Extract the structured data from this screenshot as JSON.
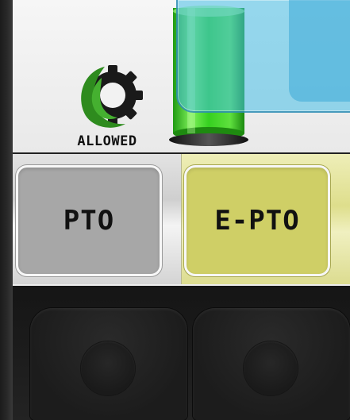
{
  "logo": {
    "label": "ALLOWED"
  },
  "buttons": {
    "pto": {
      "label": "PTO",
      "color": "#a7a7a7"
    },
    "epto": {
      "label": "E-PTO",
      "color": "#cfcf66"
    }
  },
  "colors": {
    "logo_green": "#2e8b1e",
    "tank_green": "#33cc22",
    "panel_blue": "#46bee6"
  },
  "icons": [
    "gear-leaf-logo-icon",
    "green-tank-cylinder-icon"
  ]
}
